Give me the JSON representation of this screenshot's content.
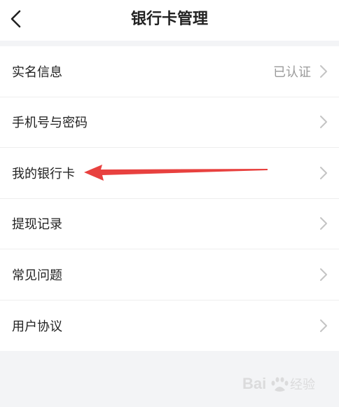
{
  "header": {
    "title": "银行卡管理",
    "back_icon": "chevron-left-icon"
  },
  "menu": {
    "items": [
      {
        "label": "实名信息",
        "status": "已认证"
      },
      {
        "label": "手机号与密码"
      },
      {
        "label": "我的银行卡"
      },
      {
        "label": "提现记录"
      },
      {
        "label": "常见问题"
      },
      {
        "label": "用户协议"
      }
    ]
  },
  "annotation": {
    "color": "#e8413f"
  },
  "watermark": {
    "text": "Bai 经验"
  }
}
